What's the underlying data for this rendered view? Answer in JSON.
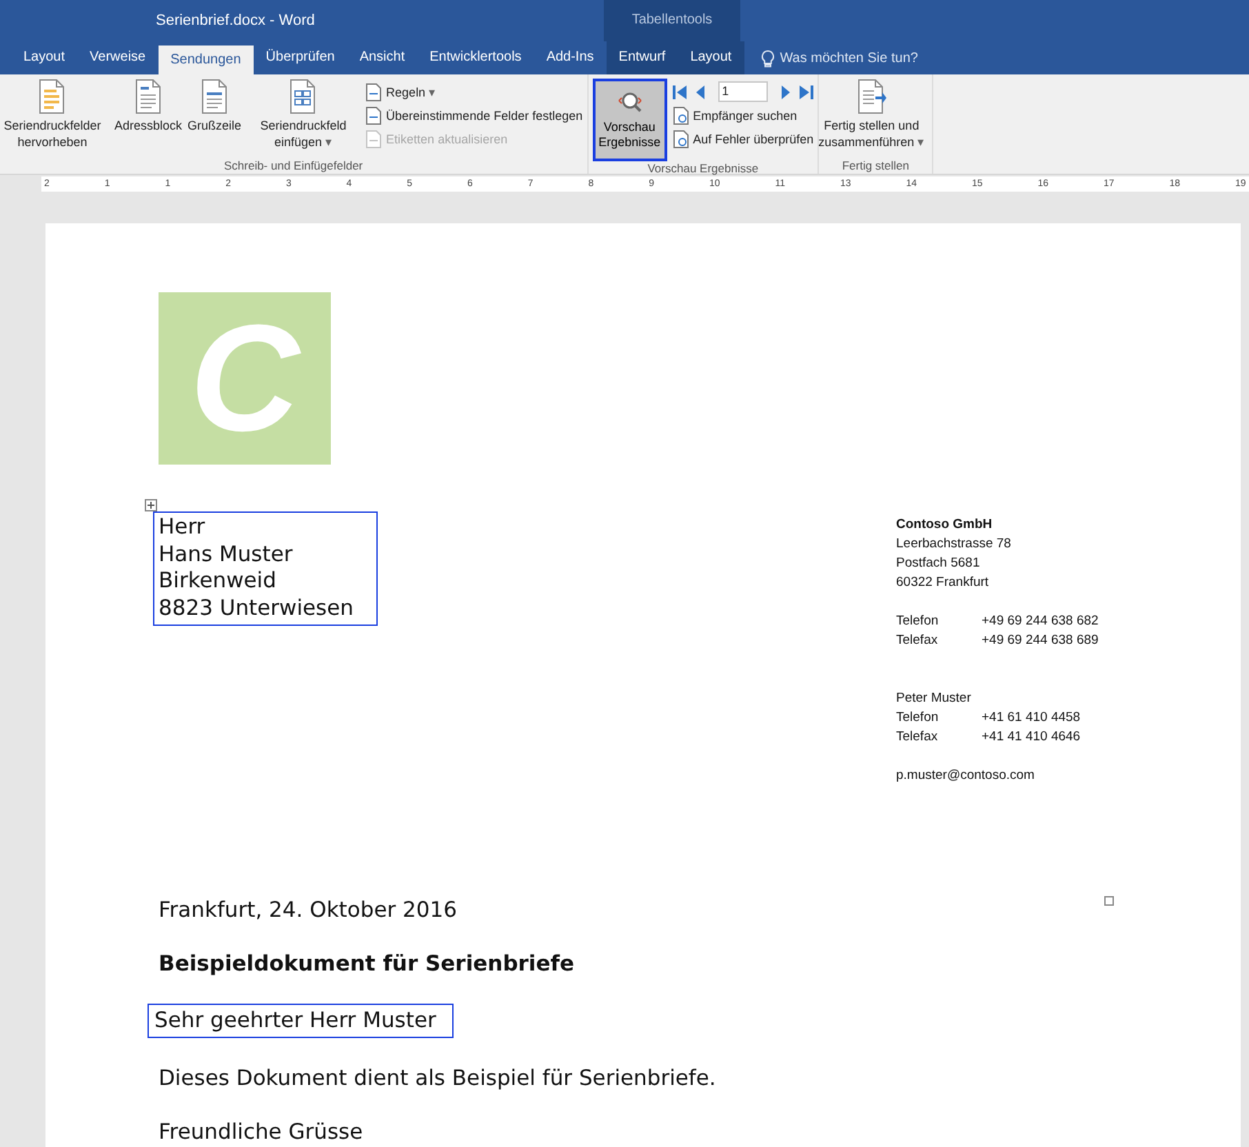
{
  "window": {
    "title": "Serienbrief.docx  -  Word",
    "context_tab_group": "Tabellentools"
  },
  "tabs": [
    {
      "label": "Layout",
      "selected": false,
      "contextual": false
    },
    {
      "label": "Verweise",
      "selected": false,
      "contextual": false
    },
    {
      "label": "Sendungen",
      "selected": true,
      "contextual": false
    },
    {
      "label": "Überprüfen",
      "selected": false,
      "contextual": false
    },
    {
      "label": "Ansicht",
      "selected": false,
      "contextual": false
    },
    {
      "label": "Entwicklertools",
      "selected": false,
      "contextual": false
    },
    {
      "label": "Add-Ins",
      "selected": false,
      "contextual": false
    },
    {
      "label": "Entwurf",
      "selected": false,
      "contextual": true
    },
    {
      "label": "Layout",
      "selected": false,
      "contextual": true
    }
  ],
  "tell_me": "Was möchten Sie tun?",
  "ribbon": {
    "groups": [
      {
        "label": "Schreib- und Einfügefelder",
        "items": [
          {
            "kind": "large",
            "label": "Seriendruckfelder hervorheben"
          },
          {
            "kind": "large",
            "label": "Adressblock"
          },
          {
            "kind": "large",
            "label": "Grußzeile"
          },
          {
            "kind": "large",
            "label": "Seriendruckfeld einfügen",
            "dropdown_arrow": "▾"
          },
          {
            "kind": "stack",
            "entries": [
              {
                "label": "Regeln",
                "dropdown_arrow": "▾",
                "disabled": false
              },
              {
                "label": "Übereinstimmende Felder festlegen",
                "disabled": false
              },
              {
                "label": "Etiketten aktualisieren",
                "disabled": true
              }
            ]
          }
        ]
      },
      {
        "label": "Vorschau Ergebnisse",
        "items": [
          {
            "kind": "toggle",
            "label": "Vorschau Ergebnisse",
            "pressed": true
          },
          {
            "kind": "nav",
            "record": "1",
            "entries": [
              {
                "label": "Empfänger suchen",
                "disabled": false
              },
              {
                "label": "Auf Fehler überprüfen",
                "disabled": false
              }
            ]
          }
        ]
      },
      {
        "label": "Fertig stellen",
        "items": [
          {
            "kind": "large",
            "label": "Fertig stellen und zusammenführen",
            "dropdown_arrow": "▾"
          }
        ]
      }
    ]
  },
  "ruler": [
    "2",
    "1",
    "1",
    "2",
    "3",
    "4",
    "5",
    "6",
    "7",
    "8",
    "9",
    "10",
    "11",
    "13",
    "14",
    "15",
    "16",
    "17",
    "18",
    "19"
  ],
  "document": {
    "logo": "C",
    "recipient": {
      "highlighted": true,
      "lines": [
        "Herr",
        "Hans Muster",
        "Birkenweid",
        "8823 Unterwiesen"
      ]
    },
    "sender": {
      "company": "Contoso GmbH",
      "address": [
        "Leerbachstrasse 78",
        "Postfach 5681",
        "60322 Frankfurt"
      ],
      "company_phones": [
        {
          "label": "Telefon",
          "value": "+49 69 244 638 682"
        },
        {
          "label": "Telefax",
          "value": "+49 69 244 638 689"
        }
      ],
      "contact": "Peter Muster",
      "contact_phones": [
        {
          "label": "Telefon",
          "value": "+41 61 410 4458"
        },
        {
          "label": "Telefax",
          "value": "+41 41 410 4646"
        }
      ],
      "email": "p.muster@contoso.com"
    },
    "date": "Frankfurt, 24. Oktober 2016",
    "subject": "Beispieldokument für Serienbriefe",
    "salutation": {
      "text": "Sehr geehrter Herr Muster",
      "highlighted": true
    },
    "body": "Dieses Dokument dient als Beispiel für Serienbriefe.",
    "closing": "Freundliche Grüsse"
  }
}
